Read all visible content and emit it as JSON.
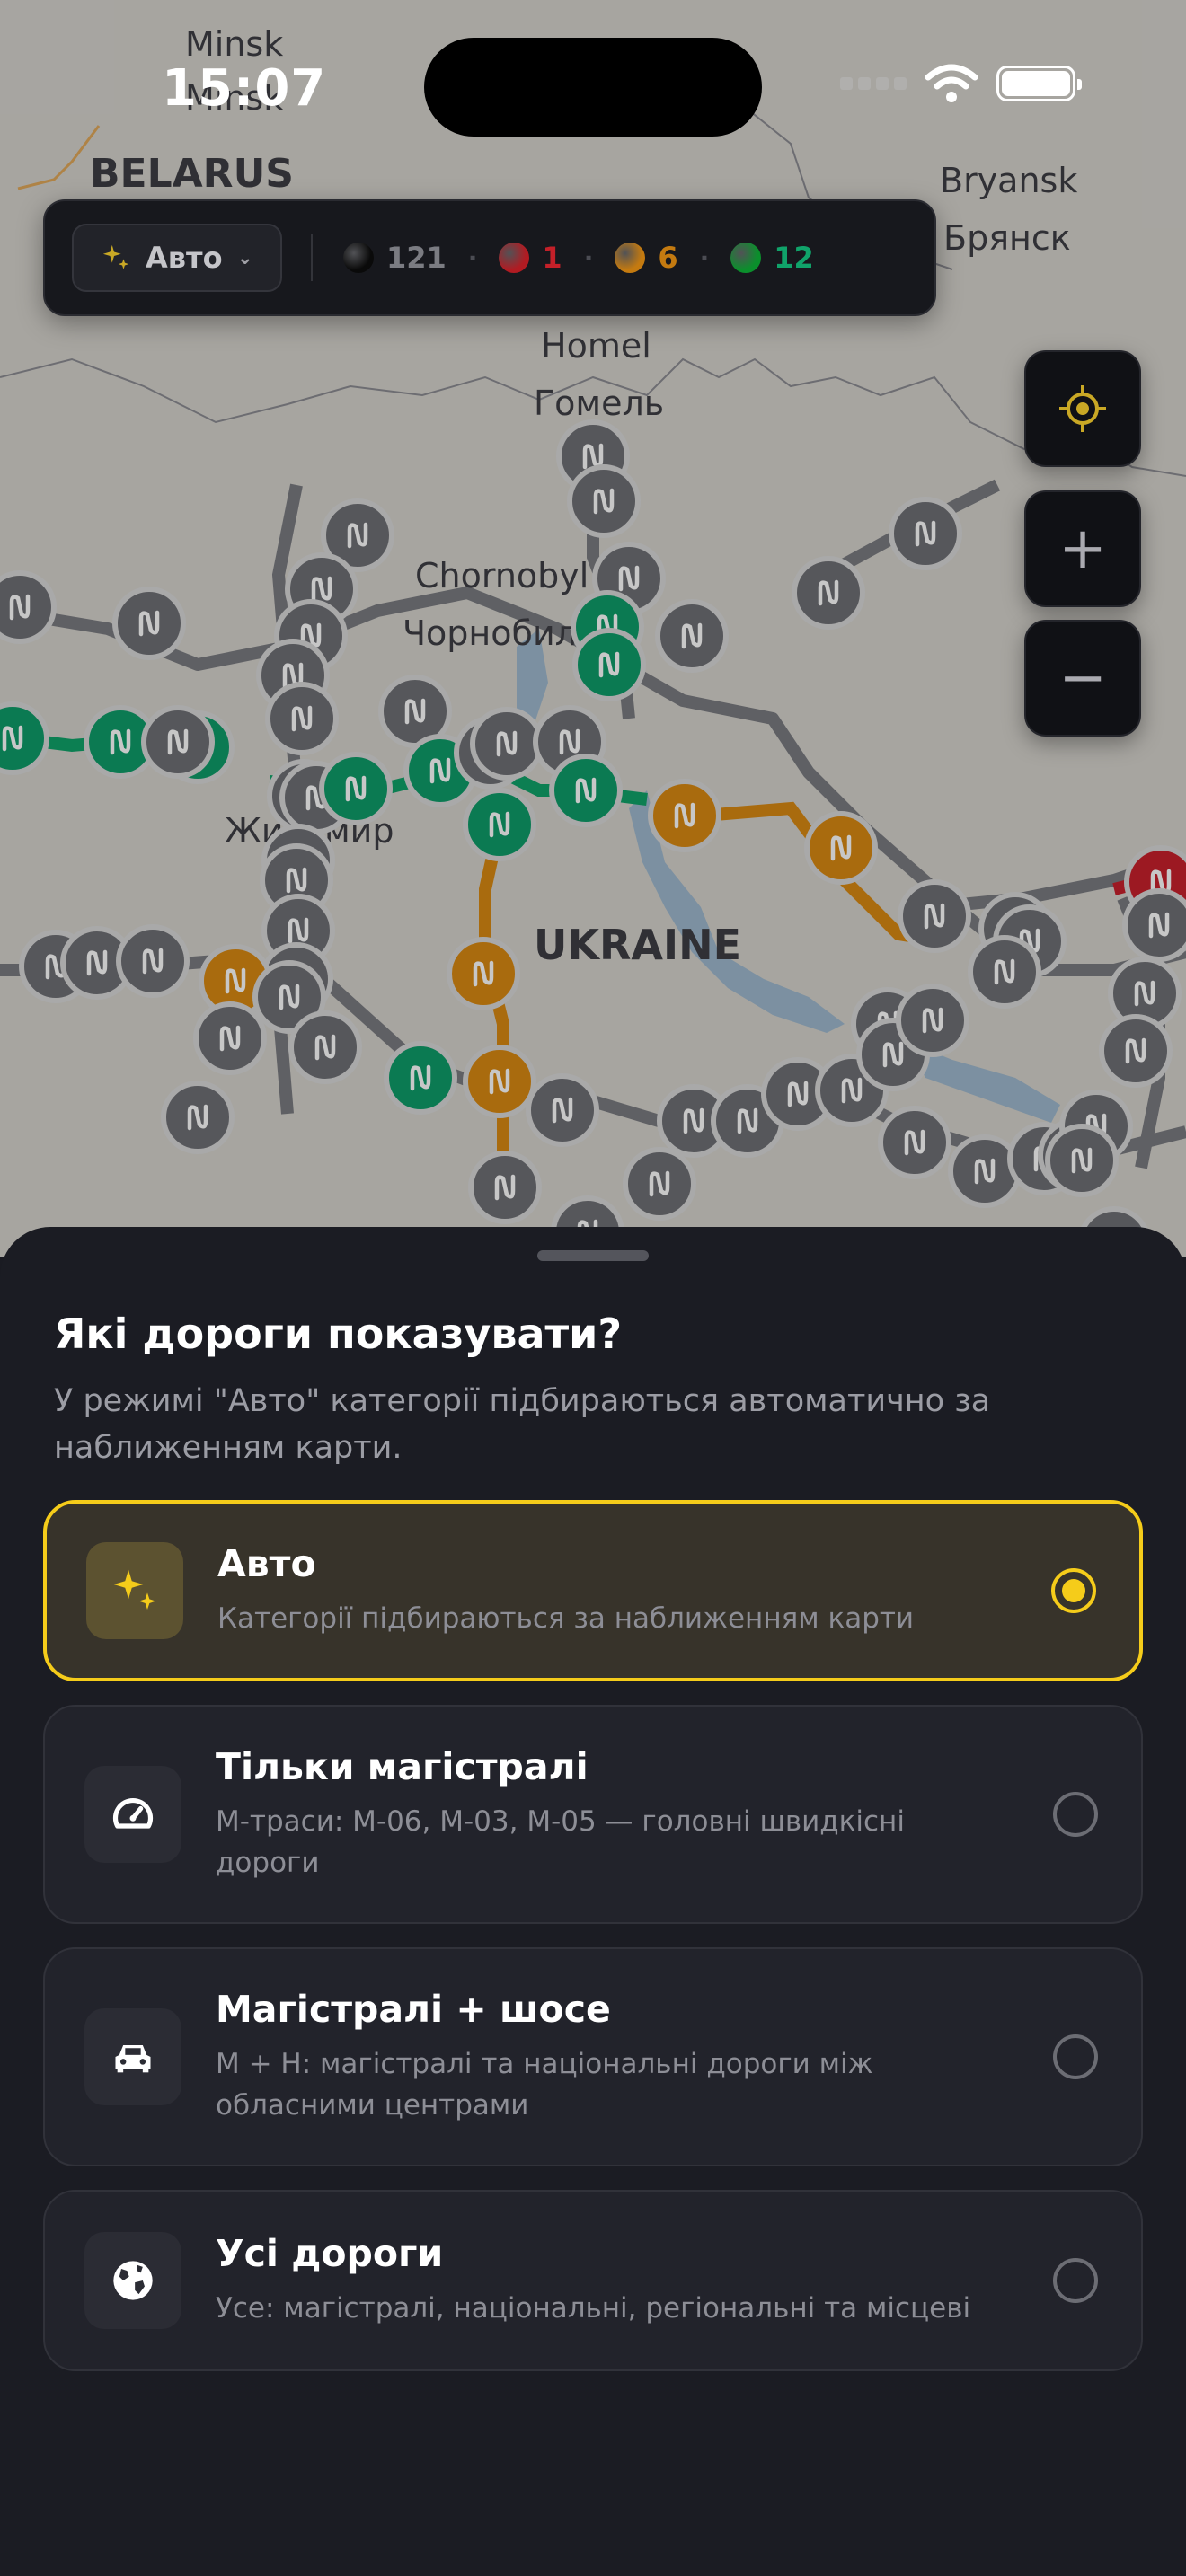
{
  "status_bar": {
    "time": "15:07",
    "icons": [
      "cellular-signal-icon",
      "wifi-icon",
      "battery-icon"
    ]
  },
  "map": {
    "labels": {
      "minsk": "Minsk",
      "belarus": "BELARUS",
      "bryansk": "Bryansk",
      "bryansk_cyr": "Брянск",
      "homel": "Homel",
      "homel_cyr": "Гомель",
      "chornobyl": "Chornobyl",
      "chornobyl_cyr": "Чорнобиль",
      "zhytomyr": "Житомир",
      "ukraine": "UKRAINE"
    },
    "marker_colors": {
      "gray": "#6f7075",
      "green": "#0f9d6a",
      "orange": "#d98912",
      "red": "#c8212c"
    }
  },
  "toolbar": {
    "mode_label": "Авто",
    "counts": [
      {
        "value": "121",
        "color": "#0a0a0a",
        "text_color": "#7b7c82"
      },
      {
        "value": "1",
        "color": "#b11b22",
        "text_color": "#c42029"
      },
      {
        "value": "6",
        "color": "#c47a10",
        "text_color": "#c47a10"
      },
      {
        "value": "12",
        "color": "#0b8f2c",
        "text_color": "#10a36a"
      }
    ]
  },
  "controls": {
    "locate": "locate-icon",
    "zoom_in": "+",
    "zoom_out": "−"
  },
  "sheet": {
    "title": "Які дороги показувати?",
    "description": "У режимі \"Авто\" категорії підбираються автоматично за наближенням карти.",
    "accent_color": "#f5cc1a",
    "options": [
      {
        "title": "Авто",
        "subtitle": "Категорії підбираються за наближенням карти",
        "icon": "sparkles-icon",
        "selected": true
      },
      {
        "title": "Тільки магістралі",
        "subtitle": "М-траси: М-06, М-03, М-05 — головні швидкісні дороги",
        "icon": "speedometer-icon",
        "selected": false
      },
      {
        "title": "Магістралі + шосе",
        "subtitle": "М + Н: магістралі та національні дороги між обласними центрами",
        "icon": "car-icon",
        "selected": false
      },
      {
        "title": "Усі дороги",
        "subtitle": "Усе: магістралі, національні, регіональні та місцеві",
        "icon": "globe-icon",
        "selected": false
      }
    ]
  }
}
